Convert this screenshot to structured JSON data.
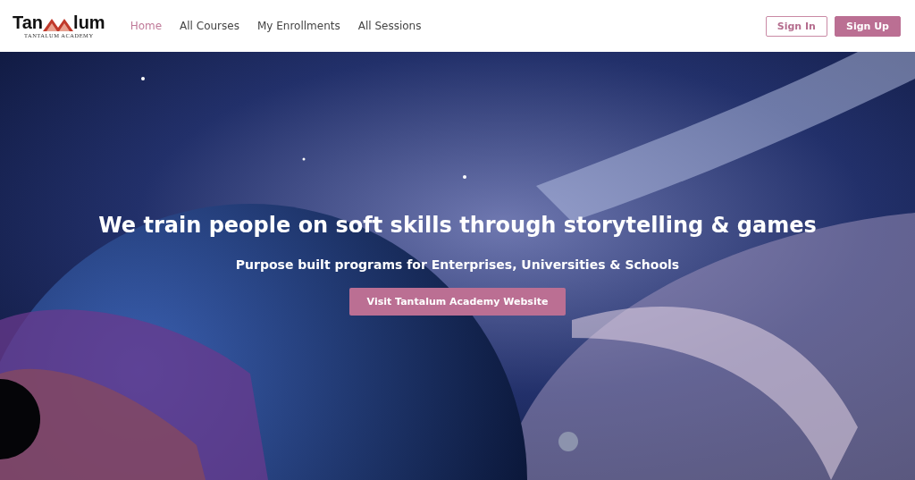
{
  "logo": {
    "left": "Tan",
    "right": "lum",
    "tagline": "TANTALUM ACADEMY"
  },
  "nav": [
    {
      "label": "Home",
      "selected": true
    },
    {
      "label": "All Courses",
      "selected": false
    },
    {
      "label": "My Enrollments",
      "selected": false
    },
    {
      "label": "All Sessions",
      "selected": false
    }
  ],
  "auth_buttons": [
    {
      "label": "Sign In",
      "kind": "outline"
    },
    {
      "label": "Sign Up",
      "kind": "filled"
    }
  ],
  "hero": {
    "kind": "picture",
    "headline": "We train people on soft skills through storytelling & games",
    "subheadline": "Purpose built programs for Enterprises, Universities & Schools",
    "cta": "Visit Tantalum Academy Website"
  }
}
